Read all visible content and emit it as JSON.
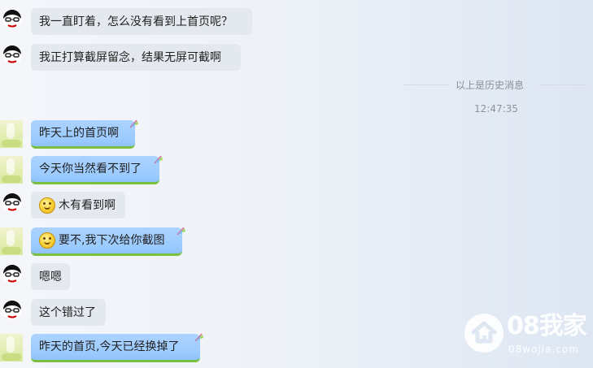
{
  "messages": [
    {
      "text": "我一直盯着，怎么没有看到上首页呢？"
    },
    {
      "text": "我正打算截屏留念，结果无屏可截啊"
    },
    {
      "text": "昨天上的首页啊"
    },
    {
      "text": "今天你当然看不到了"
    },
    {
      "text": "木有看到啊"
    },
    {
      "text": "要不,我下次给你截图"
    },
    {
      "text": "嗯嗯"
    },
    {
      "text": "这个错过了"
    },
    {
      "text": "昨天的首页,今天已经换掉了"
    }
  ],
  "history": {
    "label": "以上是历史消息",
    "time": "12:47:35"
  },
  "watermark": {
    "main": "08我家",
    "sub": "08wojia.com"
  },
  "colors": {
    "gray_bubble": "#e4e8ef",
    "blue_bubble": "#9ccbff",
    "green_underline": "#78bf42"
  },
  "icons": {
    "cartoon_avatar": "cartoon-avatar-icon",
    "photo_avatar": "photo-avatar-icon",
    "smile_emoji": "smile-emoji-icon",
    "laugh_emoji": "laugh-emoji-icon",
    "feather_tag": "feather-tag-icon",
    "home_logo": "home-logo-icon"
  }
}
